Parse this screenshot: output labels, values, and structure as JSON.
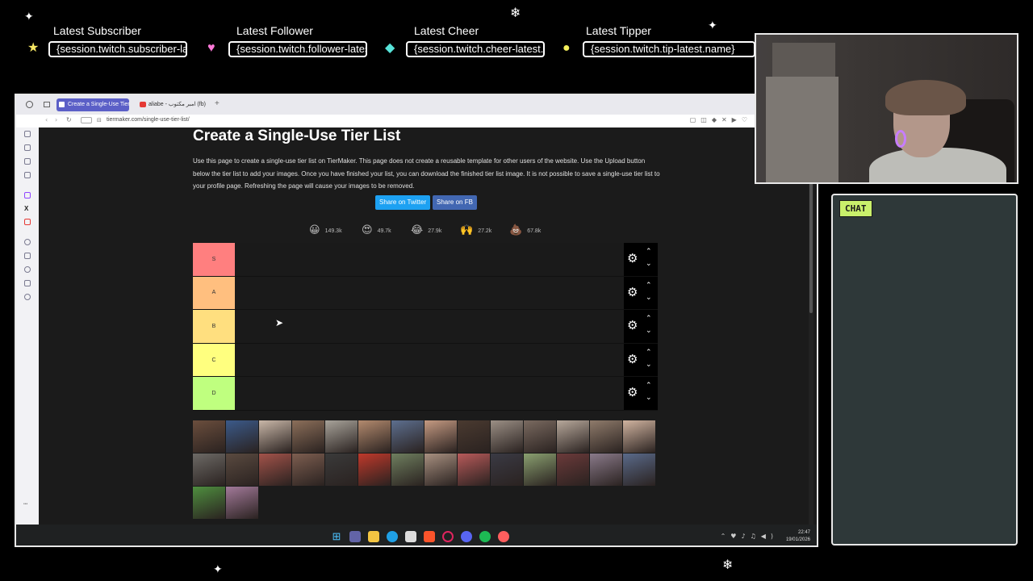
{
  "overlay": {
    "alerts": [
      {
        "title": "Latest Subscriber",
        "value": "{session.twitch.subscriber-latest.name}"
      },
      {
        "title": "Latest Follower",
        "value": "{session.twitch.follower-latest.name}"
      },
      {
        "title": "Latest Cheer",
        "value": "{session.twitch.cheer-latest.name}"
      },
      {
        "title": "Latest Tipper",
        "value": "{session.twitch.tip-latest.name}"
      }
    ],
    "chat_label": "CHAT"
  },
  "browser": {
    "tabs": [
      {
        "label": "Create a Single-Use Tier"
      },
      {
        "label": "aliabe - امبر مكتوب (fb)"
      }
    ],
    "address": "tiermaker.com/single-use-tier-list/"
  },
  "page": {
    "title": "Create a Single-Use Tier List",
    "description": "Use this page to create a single-use tier list on TierMaker. This page does not create a reusable template for other users of the website. Use the Upload button below the tier list to add your images. Once you have finished your list, you can download the finished tier list image. It is not possible to save a single-use tier list to your profile page. Refreshing the page will cause your images to be removed.",
    "share_twitter": "Share on Twitter",
    "share_fb": "Share on FB",
    "reactions": [
      {
        "icon": "grinning-face-icon",
        "glyph": "😀",
        "count": "149.3k"
      },
      {
        "icon": "heart-eyes-icon",
        "glyph": "😍",
        "count": "49.7k"
      },
      {
        "icon": "laughing-face-icon",
        "glyph": "😂",
        "count": "27.9k"
      },
      {
        "icon": "raised-hands-icon",
        "glyph": "🙌",
        "count": "27.2k"
      },
      {
        "icon": "poop-icon",
        "glyph": "💩",
        "count": "67.8k"
      }
    ],
    "tiers": [
      {
        "label": "S",
        "color": "#ff7f7f"
      },
      {
        "label": "A",
        "color": "#ffbf7f"
      },
      {
        "label": "B",
        "color": "#ffdf7f"
      },
      {
        "label": "C",
        "color": "#ffff7f"
      },
      {
        "label": "D",
        "color": "#bfff7f"
      }
    ]
  },
  "taskbar": {
    "time": "22:47",
    "date": "19/01/2026"
  }
}
